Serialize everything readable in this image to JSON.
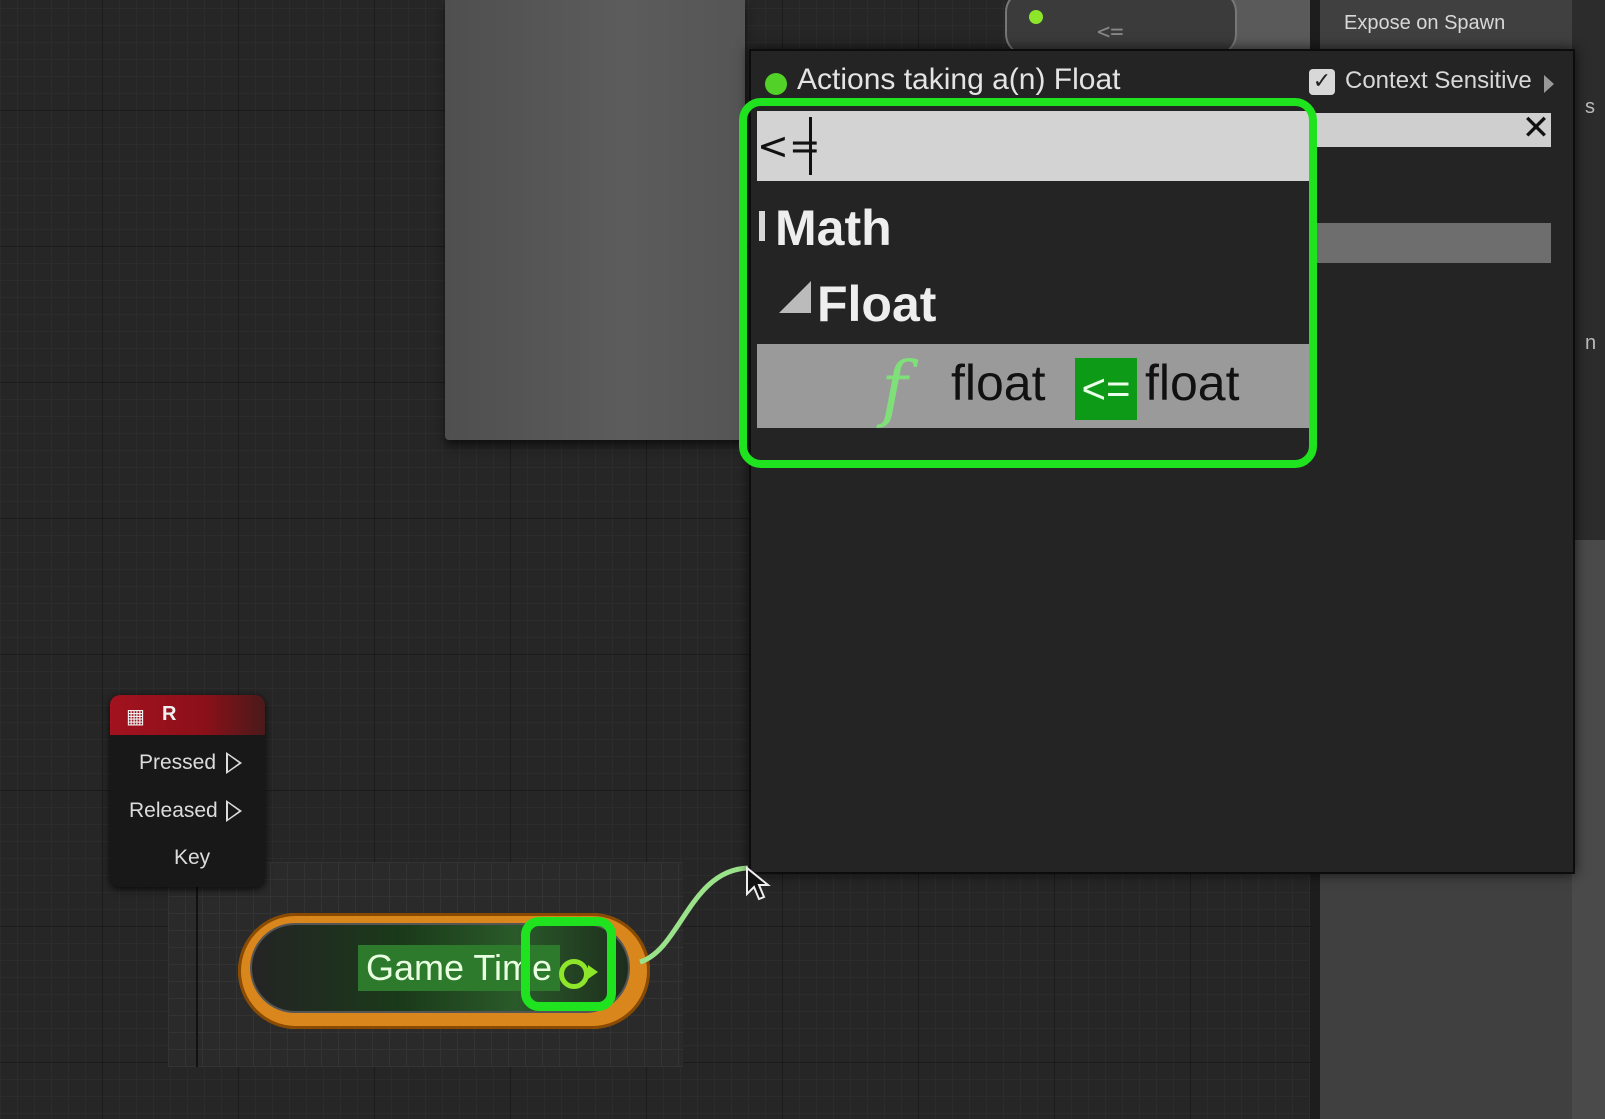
{
  "details_panel": {
    "expose_on_spawn_label": "Expose on Spawn",
    "edge_s": "s",
    "edge_n": "n"
  },
  "top_node": {
    "pin_label": "<="
  },
  "action_menu": {
    "title": "Actions taking a(n) Float",
    "context_sensitive_label": "Context Sensitive",
    "context_sensitive_checked": true,
    "search_value": "<=",
    "clear_icon": "✕",
    "categories": [
      {
        "label": "Math"
      },
      {
        "label": "Float"
      }
    ],
    "result": {
      "icon": "function-icon",
      "icon_glyph": "f",
      "left": "float",
      "operator": "<=",
      "right": "float"
    }
  },
  "r_node": {
    "title": "R",
    "pins": [
      "Pressed",
      "Released",
      "Key"
    ]
  },
  "game_time_node": {
    "label": "Game Time"
  },
  "colors": {
    "highlight": "#1ee31e",
    "float_pin": "#8ee62b",
    "event_header": "#a2121f",
    "node_outline": "#d9871d"
  }
}
